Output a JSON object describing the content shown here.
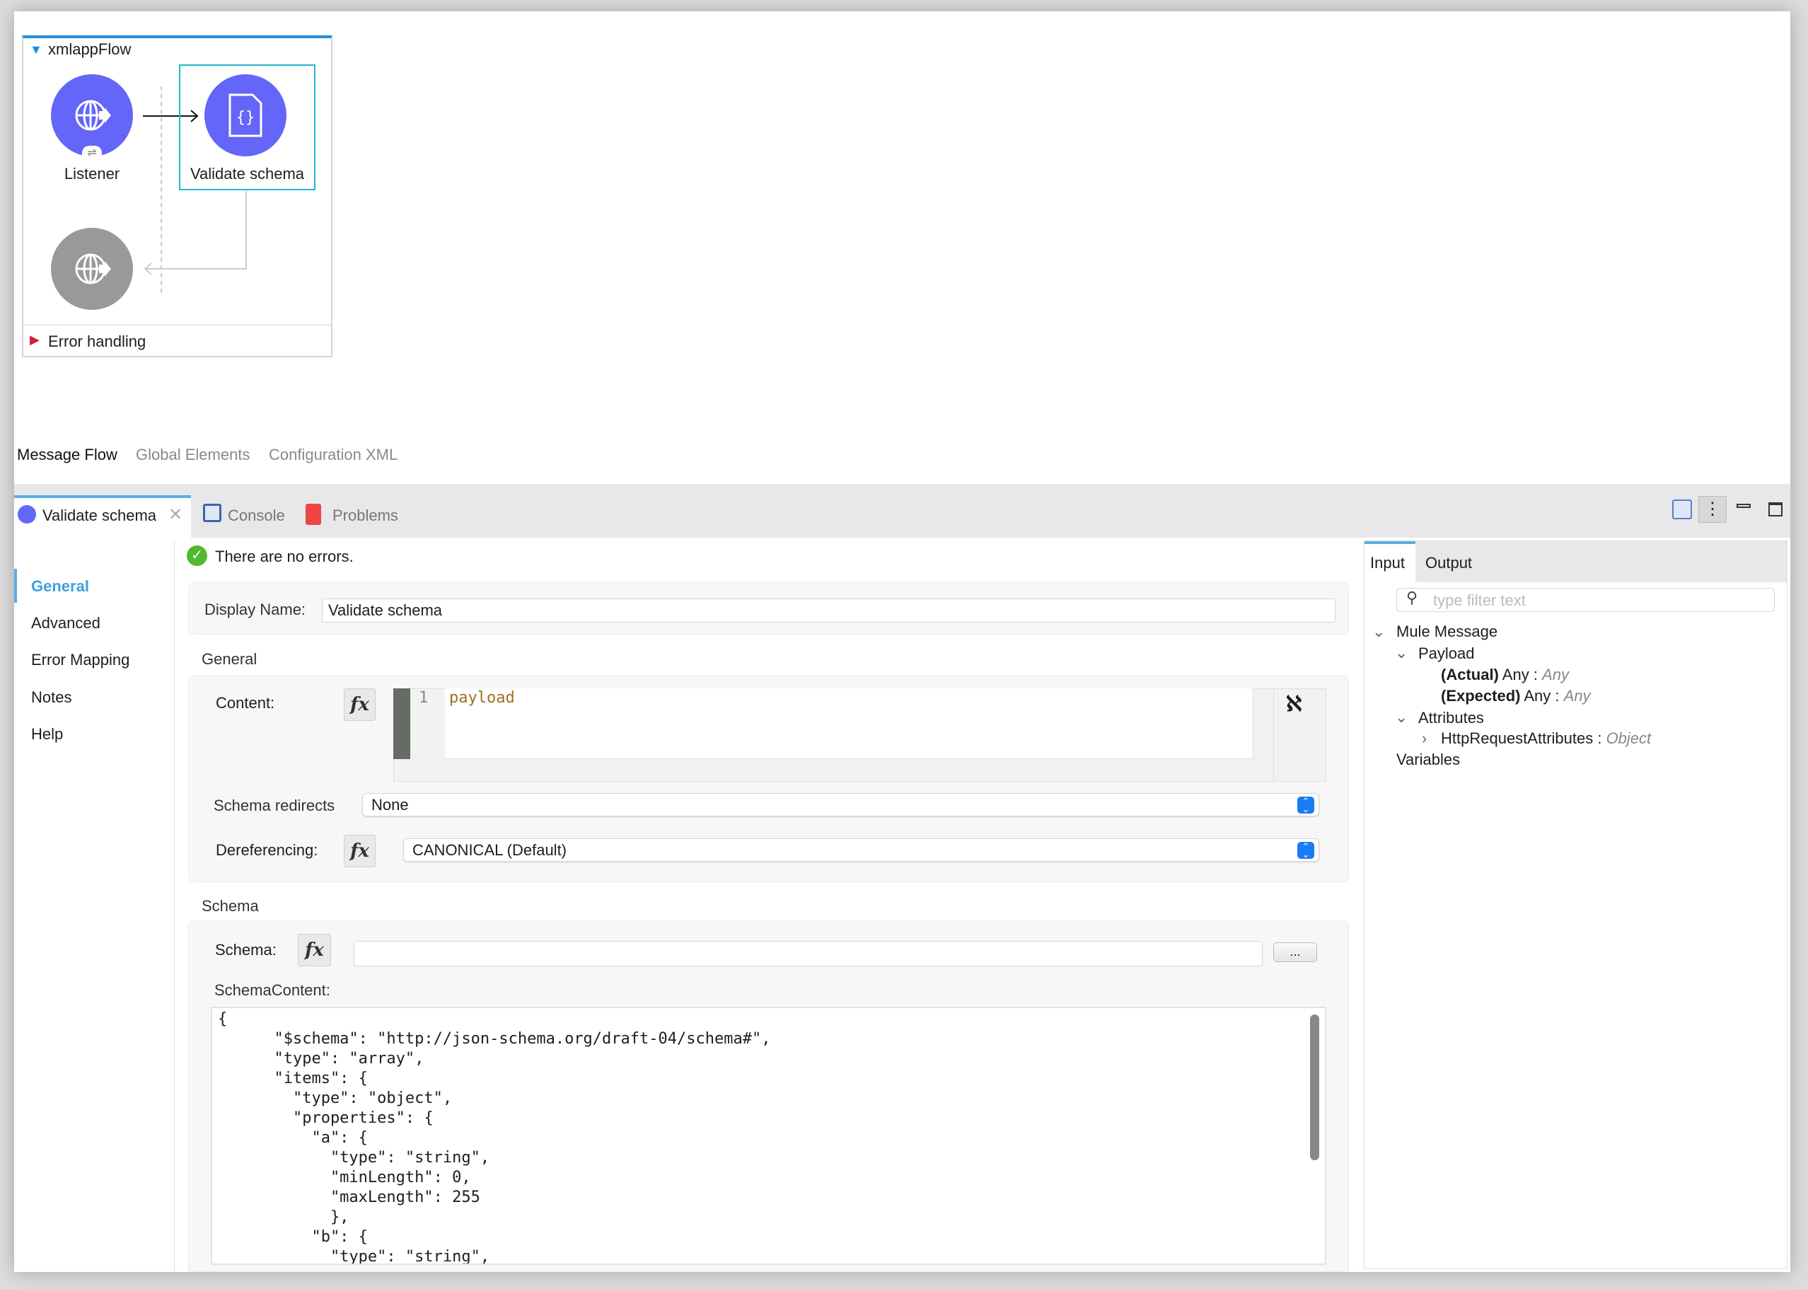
{
  "flow": {
    "name": "xmlappFlow",
    "nodes": [
      {
        "label": "Listener",
        "icon": "globe-listener-icon"
      },
      {
        "label": "Validate schema",
        "icon": "json-file-icon"
      },
      {
        "label": "",
        "icon": "globe-response-icon"
      }
    ],
    "error_handling": "Error handling"
  },
  "editor_tabs": [
    "Message Flow",
    "Global Elements",
    "Configuration XML"
  ],
  "panel_tabs": [
    {
      "label": "Validate schema",
      "icon": "validate-icon"
    },
    {
      "label": "Console",
      "icon": "console-icon"
    },
    {
      "label": "Problems",
      "icon": "problems-icon"
    }
  ],
  "nav": [
    "General",
    "Advanced",
    "Error Mapping",
    "Notes",
    "Help"
  ],
  "status": "There are no errors.",
  "display_name": {
    "label": "Display Name:",
    "value": "Validate schema"
  },
  "general": {
    "header": "General",
    "content_label": "Content:",
    "fx": "fx",
    "line_number": "1",
    "content_value": "payload",
    "schema_redirects_label": "Schema redirects",
    "schema_redirects_value": "None",
    "dereferencing_label": "Dereferencing:",
    "dereferencing_value": "CANONICAL (Default)"
  },
  "schema": {
    "header": "Schema",
    "schema_label": "Schema:",
    "schema_value": "",
    "browse": "...",
    "content_label": "SchemaContent:",
    "lines": [
      "{",
      "      \"$schema\": \"http://json-schema.org/draft-04/schema#\",",
      "      \"type\": \"array\",",
      "      \"items\": {",
      "        \"type\": \"object\",",
      "        \"properties\": {",
      "          \"a\": {",
      "            \"type\": \"string\",",
      "            \"minLength\": 0,",
      "            \"maxLength\": 255",
      "            },",
      "          \"b\": {",
      "            \"type\": \"string\","
    ]
  },
  "metadata": {
    "tabs": [
      "Input",
      "Output"
    ],
    "filter_placeholder": "type filter text",
    "tree": {
      "root": "Mule Message",
      "payload": "Payload",
      "actual_b": "(Actual)",
      "actual_t": " Any : ",
      "actual_i": "Any",
      "expected_b": "(Expected)",
      "expected_t": " Any : ",
      "expected_i": "Any",
      "attributes": "Attributes",
      "http_t": "HttpRequestAttributes : ",
      "http_i": "Object",
      "variables": "Variables"
    }
  },
  "colors": {
    "accent": "#1e90e0",
    "node": "#6366f8",
    "selection": "#22b5d0",
    "payload_text": "#a0701e"
  }
}
